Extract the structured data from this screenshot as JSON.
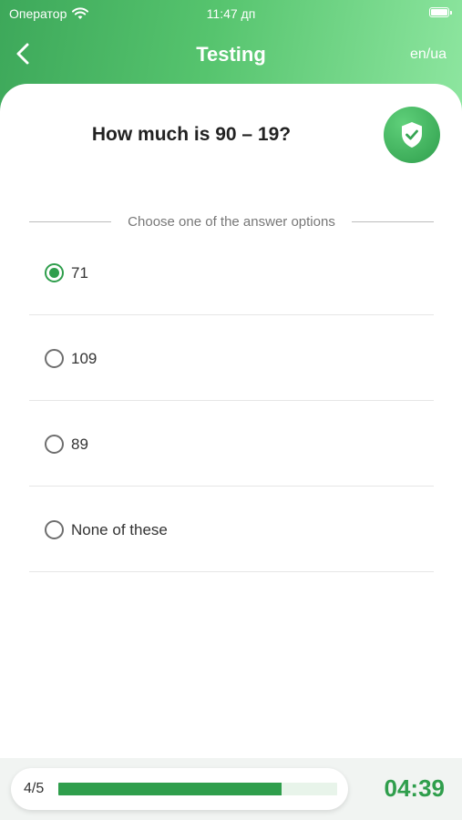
{
  "status_bar": {
    "carrier": "Оператор",
    "time": "11:47 дп"
  },
  "nav": {
    "title": "Testing",
    "language": "en/ua",
    "back_icon": "chevron-left-icon"
  },
  "question": {
    "text": "How much is 90 – 19?",
    "badge_icon": "shield-check-icon"
  },
  "instruction": "Choose one of the answer options",
  "options": [
    {
      "label": "71",
      "selected": true
    },
    {
      "label": "109",
      "selected": false
    },
    {
      "label": "89",
      "selected": false
    },
    {
      "label": "None of these",
      "selected": false
    }
  ],
  "progress": {
    "label": "4/5",
    "fraction": 0.8
  },
  "timer": "04:39",
  "colors": {
    "accent": "#2f9e4c",
    "header_start": "#3da85a",
    "header_end": "#8ee6a0"
  }
}
